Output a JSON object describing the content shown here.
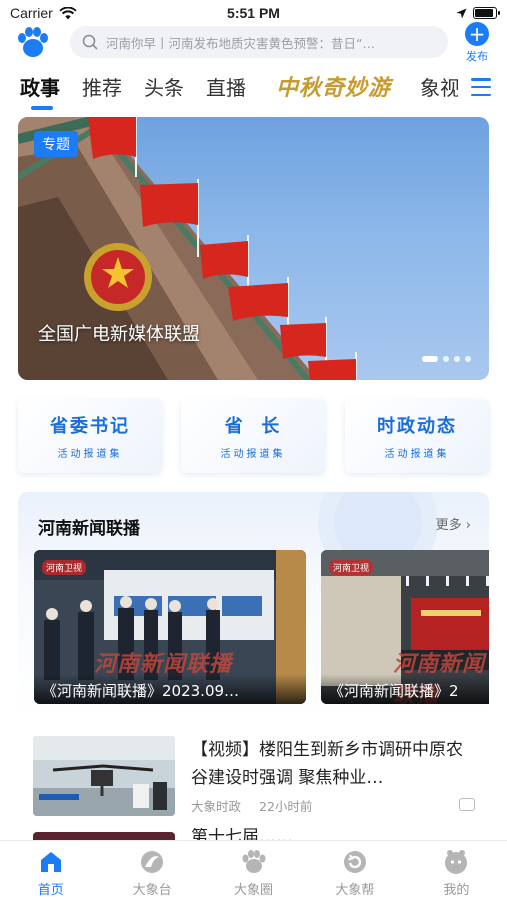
{
  "status_bar": {
    "carrier": "Carrier",
    "time": "5:51 PM"
  },
  "header": {
    "search_placeholder": "河南你早丨河南发布地质灾害黄色预警：昔日“…",
    "publish_label": "发布"
  },
  "tabs": [
    "政事",
    "推荐",
    "头条",
    "直播",
    "中秋奇妙游",
    "象视"
  ],
  "active_tab": "政事",
  "banner": {
    "badge": "专题",
    "caption": "全国广电新媒体联盟",
    "page_count": 4,
    "current_page": 1
  },
  "quick_cards": [
    {
      "title": "省委书记",
      "subtitle": "活动报道集"
    },
    {
      "title": "省  长",
      "subtitle": "活动报道集"
    },
    {
      "title": "时政动态",
      "subtitle": "活动报道集"
    }
  ],
  "news_section": {
    "title": "河南新闻联播",
    "more": "更多",
    "videos": [
      {
        "caption": "《河南新闻联播》2023.09…",
        "watermark": "河南新闻联播",
        "channel": "河南卫视"
      },
      {
        "caption": "《河南新闻联播》2",
        "watermark": "河南新闻联播",
        "channel": "河南卫视"
      }
    ]
  },
  "articles": [
    {
      "title": "【视频】楼阳生到新乡市调研中原农谷建设时强调 聚焦种业…",
      "source": "大象时政",
      "time": "22小时前"
    },
    {
      "title": "第十七届……"
    }
  ],
  "tab_bar": [
    {
      "label": "首页",
      "icon": "home-icon"
    },
    {
      "label": "大象台",
      "icon": "tv-icon"
    },
    {
      "label": "大象圈",
      "icon": "paw-icon"
    },
    {
      "label": "大象帮",
      "icon": "refresh-icon"
    },
    {
      "label": "我的",
      "icon": "profile-icon"
    }
  ],
  "colors": {
    "accent": "#1b7cf5",
    "special_tab": "#c99a2e",
    "card_text": "#1b6ed8"
  }
}
